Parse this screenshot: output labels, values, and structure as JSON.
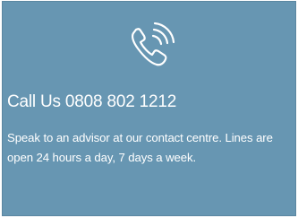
{
  "contact_card": {
    "icon": "phone-icon",
    "title": "Call Us 0808 802 1212",
    "description": "Speak to an advisor at our contact centre. Lines are open 24 hours a day, 7 days a week.",
    "colors": {
      "background": "#6796b2",
      "text": "#ffffff"
    }
  }
}
